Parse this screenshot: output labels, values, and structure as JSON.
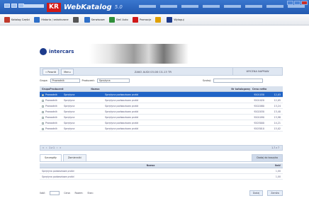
{
  "window": {
    "brand_logo": "KR",
    "brand_name": "WebKatalog",
    "version": "5.0"
  },
  "toolbar": {
    "items": [
      {
        "label": "Katalog Części",
        "icon": "catalog-icon",
        "color": "#c0392b"
      },
      {
        "label": "Historia / zakończone",
        "icon": "history-icon",
        "color": "#2e6fc8"
      },
      {
        "label": "",
        "icon": "cart-icon",
        "color": "#555555"
      },
      {
        "label": "Serwisowe",
        "icon": "search-icon",
        "color": "#2e6fc8"
      },
      {
        "label": "Sieć Auto",
        "icon": "car-icon",
        "color": "#2f8f3a"
      },
      {
        "label": "Promocje",
        "icon": "promo-icon",
        "color": "#d01818"
      },
      {
        "label": "",
        "icon": "user-icon",
        "color": "#e0a000"
      },
      {
        "label": "Wyloguj",
        "icon": "logout-icon",
        "color": "#1d3b8c"
      }
    ]
  },
  "header": {
    "company": "intercars"
  },
  "nav": {
    "back": "« Powrót",
    "menu": "Menu",
    "ident": "ZAKO AUDI 03.08 CG.13 TR",
    "right": "WYCENA NAPRAW"
  },
  "filter": {
    "group_label": "Grupa:",
    "group_value": "Prowadnik",
    "producer_label": "Producent:",
    "producer_value": "Sprężyna",
    "search_label": "Szukaj:"
  },
  "table": {
    "headers": [
      "Grupa",
      "Producent",
      "Nazwa",
      "Nr katalogowy",
      "Cena netto"
    ],
    "rows": [
      [
        "Prowadnik",
        "Sprężyna",
        "Sprężyna podwoziowa przód",
        "9201030",
        "12,03"
      ],
      [
        "Prowadnik",
        "Sprężyna",
        "Sprężyna podwoziowa przód",
        "9201020",
        "12,05"
      ],
      [
        "Prowadnik",
        "Sprężyna",
        "Sprężyna podwoziowa przód",
        "9202080",
        "13,24"
      ],
      [
        "Prowadnik",
        "Sprężyna",
        "Sprężyna podwoziowa przód",
        "9202030",
        "13,40"
      ],
      [
        "Prowadnik",
        "Sprężyna",
        "Sprężyna podwoziowa przód",
        "9201090",
        "13,98"
      ],
      [
        "Prowadnik",
        "Sprężyna",
        "Sprężyna podwoziowa przód",
        "9203000",
        "14,21"
      ],
      [
        "Prowadnik",
        "Sprężyna",
        "Sprężyna podwoziowa przód",
        "9203010",
        "15,02"
      ]
    ]
  },
  "pager": {
    "text": "1 z 1",
    "right": "1-7 z 7"
  },
  "tabs": {
    "tab1": "Szczegóły",
    "tab2": "Zamienniki",
    "tab3": "Dodaj do koszyka"
  },
  "sub": {
    "headers": [
      "Nazwa",
      "Ilość"
    ],
    "rows": [
      [
        "Sprężyna podwoziowa przód",
        "1,00"
      ],
      [
        "Sprężyna podwoziowa przód",
        "1,00"
      ]
    ]
  },
  "footer": {
    "qty_label": "Ilość:",
    "price_label": "Cena:",
    "total_label": "Razem:",
    "stock_label": "Stan:",
    "btn1": "Dodaj",
    "btn2": "Zamów"
  }
}
